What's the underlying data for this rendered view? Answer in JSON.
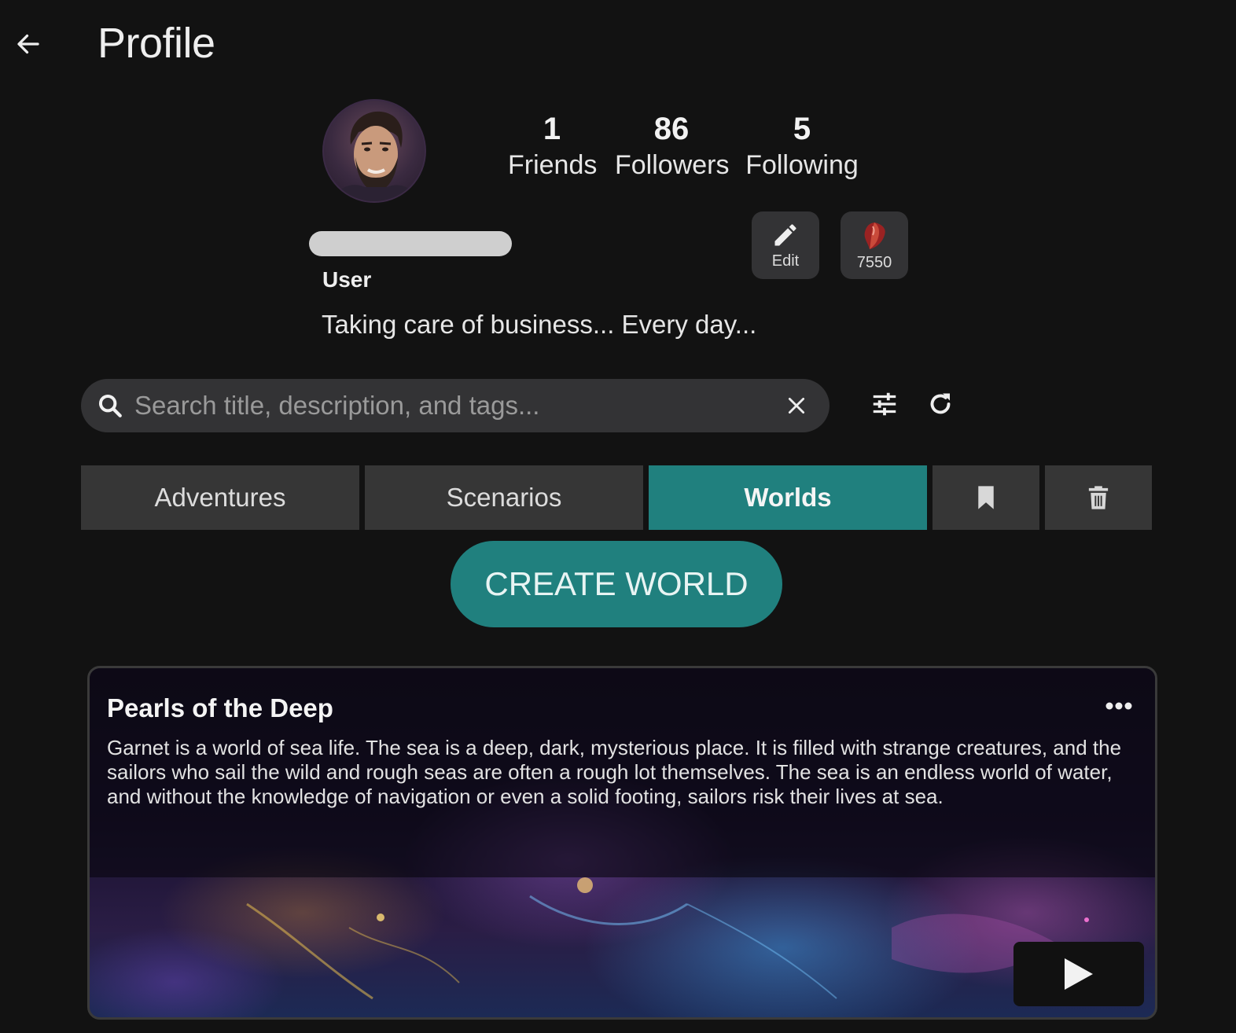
{
  "header": {
    "title": "Profile",
    "back_icon": "arrow-left-icon"
  },
  "profile": {
    "avatar_icon": "user-avatar",
    "role": "User",
    "bio": "Taking care of business... Every day...",
    "stats": [
      {
        "value": "1",
        "label": "Friends"
      },
      {
        "value": "86",
        "label": "Followers"
      },
      {
        "value": "5",
        "label": "Following"
      }
    ],
    "edit_label": "Edit",
    "currency_value": "7550",
    "currency_icon": "gem-icon"
  },
  "search": {
    "placeholder": "Search title, description, and tags...",
    "value": ""
  },
  "tabs": [
    {
      "label": "Adventures",
      "active": false
    },
    {
      "label": "Scenarios",
      "active": false
    },
    {
      "label": "Worlds",
      "active": true
    }
  ],
  "icon_tabs": [
    "bookmark-icon",
    "trash-icon"
  ],
  "create_button": "CREATE WORLD",
  "card": {
    "title": "Pearls of the Deep",
    "description": "Garnet is a world of sea life. The sea is a deep, dark, mysterious place. It is filled with strange creatures, and the sailors who sail the wild and rough seas are often a rough lot themselves. The sea is an endless world of water, and without the knowledge of navigation or even a solid footing, sailors risk their lives at sea."
  },
  "colors": {
    "background": "#121212",
    "accent": "#20807e",
    "surface": "#363636"
  }
}
